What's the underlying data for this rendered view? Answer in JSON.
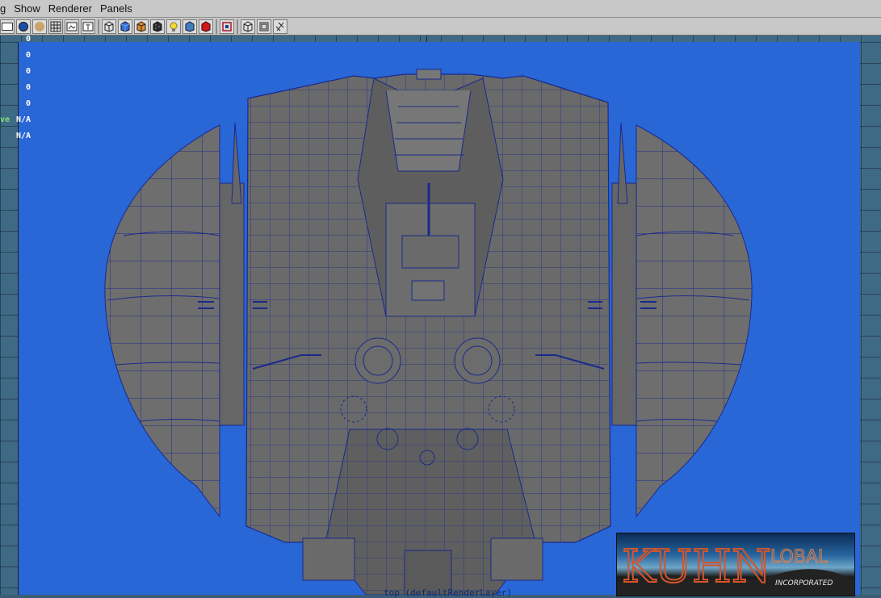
{
  "menu": {
    "items": [
      "g",
      "Show",
      "Renderer",
      "Panels"
    ]
  },
  "toolbar": {
    "icons": [
      "camera-attr-icon",
      "select-camera-icon",
      "lock-camera-icon",
      "grid-icon",
      "image-plane-icon",
      "resolution-gate-icon",
      "wireframe-icon",
      "smooth-shade-icon",
      "shaded-wireframe-icon",
      "textured-icon",
      "lights-icon",
      "shadows-icon",
      "xray-icon",
      "isolate-icon",
      "frame-all-icon",
      "frame-selection-icon",
      "snapshot-icon"
    ]
  },
  "hud": {
    "rows": [
      "0",
      "0",
      "0",
      "0",
      "0",
      "N/A",
      "N/A"
    ],
    "left_cut_label": "ve"
  },
  "viewport": {
    "background": "#2966d6",
    "camera_label": "top (defaultRenderLayer)"
  },
  "logo": {
    "main_text": "KUHN",
    "sub_text": "LOBAL",
    "tagline": "INCORPORATED"
  },
  "colors": {
    "mesh_fill": "#6e6e6e",
    "wire": "#1a2a8a",
    "menubar": "#c8c8c8"
  }
}
